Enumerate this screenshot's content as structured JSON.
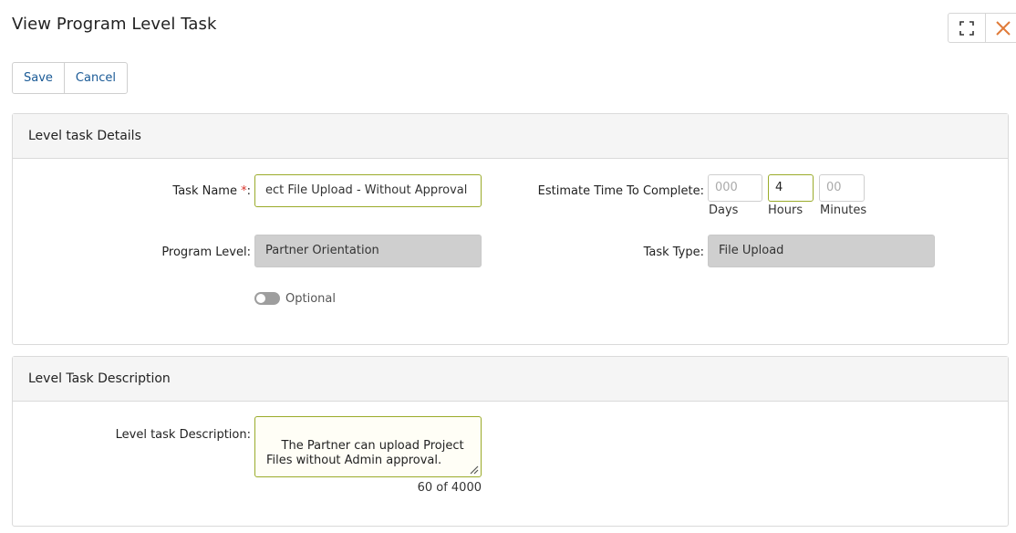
{
  "header": {
    "title": "View Program Level Task",
    "expand_icon": "expand-icon",
    "close_icon": "close-icon",
    "close_color": "#e07b39"
  },
  "toolbar": {
    "save_label": "Save",
    "cancel_label": "Cancel"
  },
  "details": {
    "section_title": "Level task Details",
    "task_name_label": "Task Name",
    "required_mark": "*",
    "label_colon": ":",
    "task_name_value": "ect File Upload - Without Approval",
    "estimate_label": "Estimate Time To Complete:",
    "days_placeholder": "000",
    "days_caption": "Days",
    "hours_value": "4",
    "hours_caption": "Hours",
    "minutes_placeholder": "00",
    "minutes_caption": "Minutes",
    "program_level_label": "Program Level:",
    "program_level_value": "Partner Orientation",
    "task_type_label": "Task Type:",
    "task_type_value": "File Upload",
    "optional_label": "Optional",
    "optional_on": false
  },
  "description": {
    "section_title": "Level Task Description",
    "field_label": "Level task Description:",
    "value": "The Partner can upload Project\nFiles without Admin approval.",
    "counter": "60 of 4000"
  },
  "colors": {
    "accent_border": "#9aab2a",
    "link_blue": "#1a5a96",
    "readonly_bg": "#cfcfcf",
    "required_red": "#d9342b"
  }
}
